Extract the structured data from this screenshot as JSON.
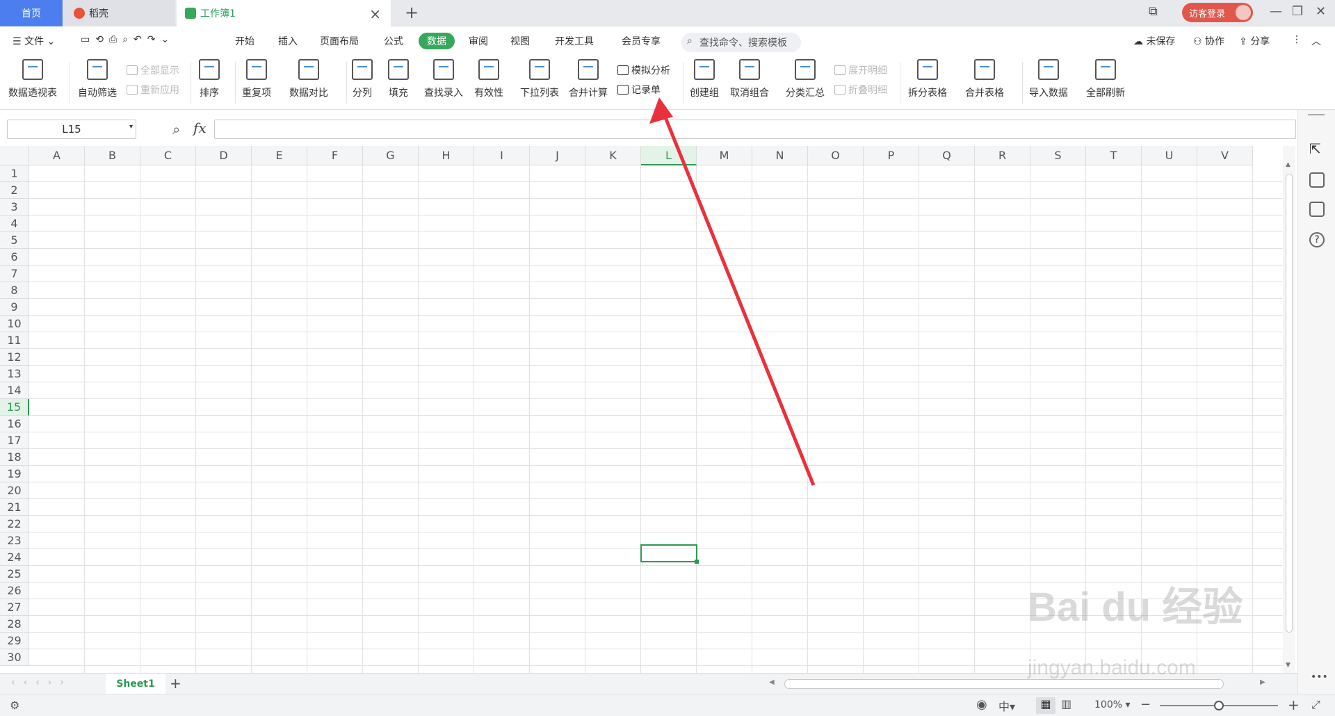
{
  "tabs": {
    "home": "首页",
    "daoke": "稻壳",
    "workbook": "工作簿1"
  },
  "login": "访客登录",
  "menu": {
    "file": "文件",
    "items": [
      "开始",
      "插入",
      "页面布局",
      "公式",
      "数据",
      "审阅",
      "视图",
      "开发工具",
      "会员专享"
    ],
    "search": "查找命令、搜索模板",
    "unsaved": "未保存",
    "collab": "协作",
    "share": "分享"
  },
  "ribbon": {
    "pivot": "数据透视表",
    "autofilter": "自动筛选",
    "show_all": "全部显示",
    "reapply": "重新应用",
    "sort": "排序",
    "dup": "重复项",
    "compare": "数据对比",
    "split": "分列",
    "fill": "填充",
    "lookup": "查找录入",
    "validity": "有效性",
    "dropdown": "下拉列表",
    "consolidate": "合并计算",
    "whatif": "模拟分析",
    "record": "记录单",
    "group": "创建组",
    "ungroup": "取消组合",
    "subtotal": "分类汇总",
    "expand": "展开明细",
    "collapse": "折叠明细",
    "split_table": "拆分表格",
    "merge_table": "合并表格",
    "import": "导入数据",
    "refresh": "全部刷新"
  },
  "namebox": "L15",
  "fx": "fx",
  "columns": [
    "A",
    "B",
    "C",
    "D",
    "E",
    "F",
    "G",
    "H",
    "I",
    "J",
    "K",
    "L",
    "M",
    "N",
    "O",
    "P",
    "Q",
    "R",
    "S",
    "T",
    "U",
    "V"
  ],
  "rows": [
    "1",
    "2",
    "3",
    "4",
    "5",
    "6",
    "7",
    "8",
    "9",
    "10",
    "11",
    "12",
    "13",
    "14",
    "15",
    "16",
    "17",
    "18",
    "19",
    "20",
    "21",
    "22",
    "23",
    "24",
    "25",
    "26",
    "27",
    "28",
    "29",
    "30"
  ],
  "selected": {
    "column": "L",
    "row": "15"
  },
  "sheet": "Sheet1",
  "zoom": "100%",
  "watermark": {
    "main": "Bai du 经验",
    "sub": "jingyan.baidu.com"
  },
  "colors": {
    "accent": "#37a85b",
    "arrow": "#e8323b",
    "tab_home": "#4d7ef0"
  }
}
